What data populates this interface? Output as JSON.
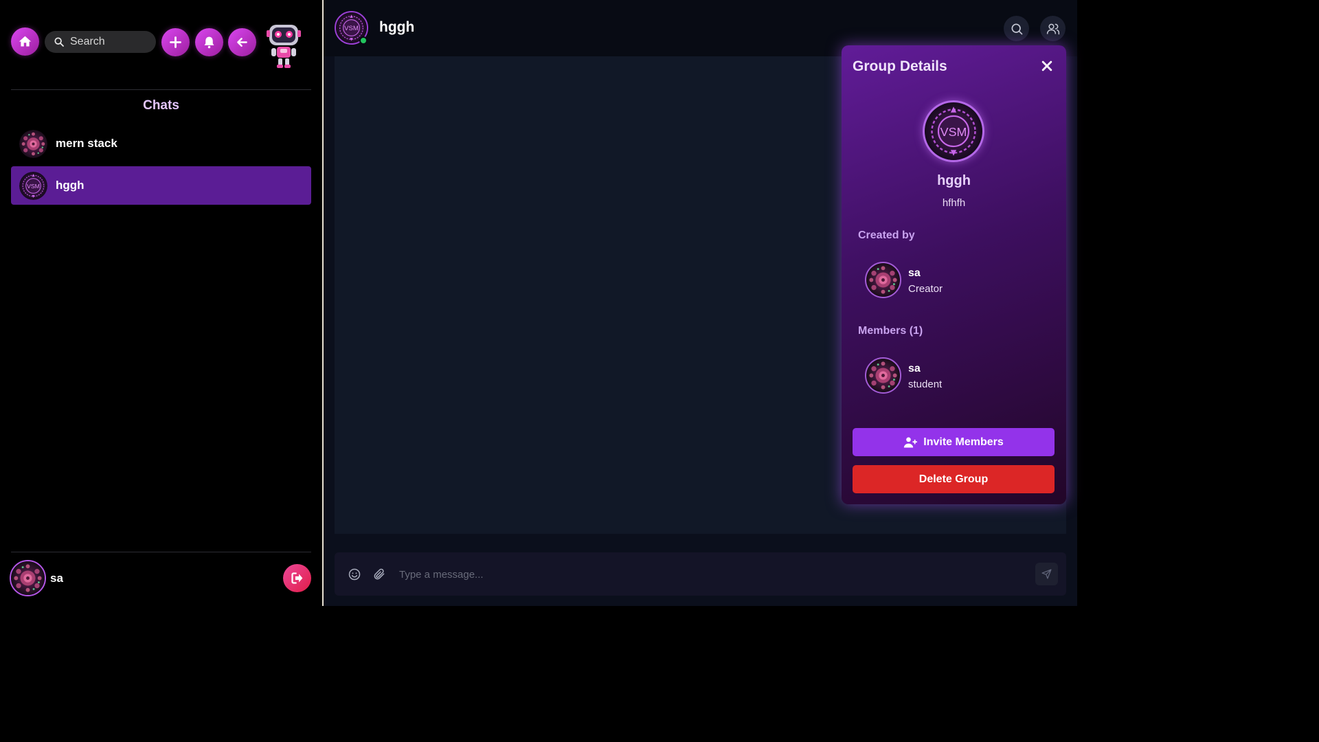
{
  "sidebar": {
    "search_placeholder": "Search",
    "chats_heading": "Chats",
    "chats": [
      {
        "name": "mern stack",
        "active": false,
        "avatar": "rose-avatar"
      },
      {
        "name": "hggh",
        "active": true,
        "avatar": "vsm-avatar"
      }
    ],
    "current_user": {
      "name": "sa",
      "avatar": "rose-avatar"
    }
  },
  "chat": {
    "title": "hggh",
    "online": true,
    "composer_placeholder": "Type a message..."
  },
  "group_panel": {
    "title": "Group Details",
    "group_name": "hggh",
    "group_description": "hfhfh",
    "created_by_label": "Created by",
    "creator": {
      "name": "sa",
      "role": "Creator"
    },
    "members_label": "Members (1)",
    "members": [
      {
        "name": "sa",
        "role": "student"
      }
    ],
    "invite_label": "Invite Members",
    "delete_label": "Delete Group"
  },
  "icons": {
    "home": "home-icon",
    "search": "search-icon",
    "add": "plus-icon",
    "notifications": "bell-icon",
    "back": "arrow-left-icon",
    "logout": "logout-icon",
    "members": "users-icon",
    "close": "close-icon",
    "emoji": "smiley-icon",
    "attach": "paperclip-icon",
    "send": "send-icon",
    "invite": "user-plus-icon"
  },
  "colors": {
    "accent": "#d946ef",
    "active_chat": "#5b1d95",
    "panel_purple": "#611c98",
    "invite": "#9333ea",
    "danger": "#dc2626",
    "online": "#22c55e"
  }
}
